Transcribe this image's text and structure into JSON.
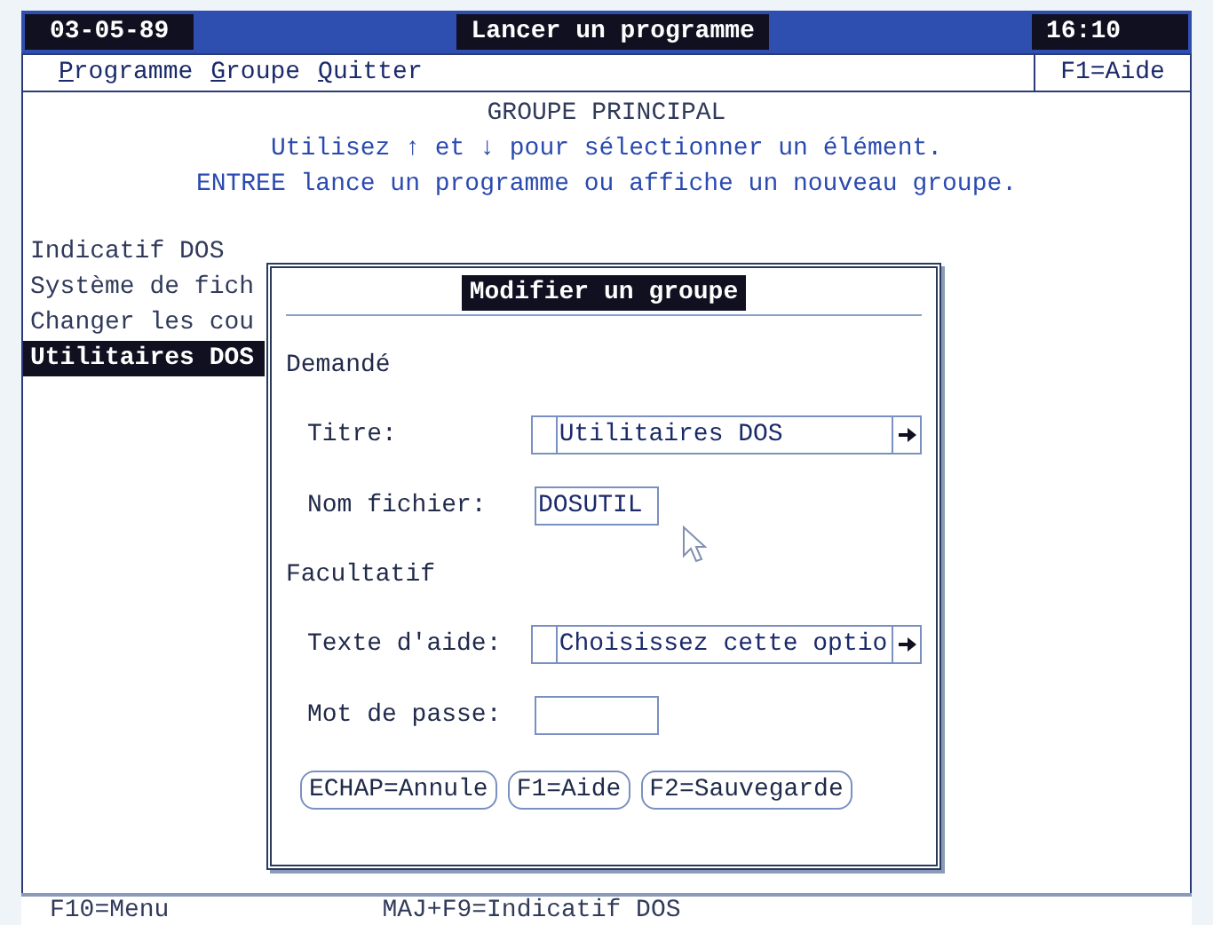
{
  "title_bar": {
    "date": "03-05-89",
    "title": "Lancer un programme",
    "time": "16:10"
  },
  "menu_bar": {
    "items": [
      {
        "label": "Programme"
      },
      {
        "label": "Groupe"
      },
      {
        "label": "Quitter"
      }
    ],
    "help": "F1=Aide"
  },
  "main": {
    "group_title": "GROUPE PRINCIPAL",
    "instructions": [
      "Utilisez ↑ et ↓ pour sélectionner un élément.",
      "ENTREE lance un programme ou affiche un nouveau groupe."
    ],
    "items": [
      {
        "label": "Indicatif DOS",
        "selected": false
      },
      {
        "label": "Système de fich",
        "selected": false
      },
      {
        "label": "Changer les cou",
        "selected": false
      },
      {
        "label": "Utilitaires DOS",
        "selected": true
      }
    ]
  },
  "dialog": {
    "title": "Modifier un groupe",
    "sections": [
      {
        "heading": "Demandé",
        "fields": [
          {
            "label": "Titre:",
            "value": "Utilitaires DOS",
            "scroll_arrow": true
          },
          {
            "label": "Nom fichier:",
            "value": "DOSUTIL",
            "scroll_arrow": false
          }
        ]
      },
      {
        "heading": "Facultatif",
        "fields": [
          {
            "label": "Texte d'aide:",
            "value": "Choisissez cette optio",
            "scroll_arrow": true
          },
          {
            "label": "Mot de passe:",
            "scroll_arrow": false
          }
        ]
      }
    ],
    "buttons": [
      "ECHAP=Annule",
      "F1=Aide",
      "F2=Sauvegarde"
    ]
  },
  "status_bar": [
    "F10=Menu",
    "MAJ+F9=Indicatif DOS"
  ]
}
